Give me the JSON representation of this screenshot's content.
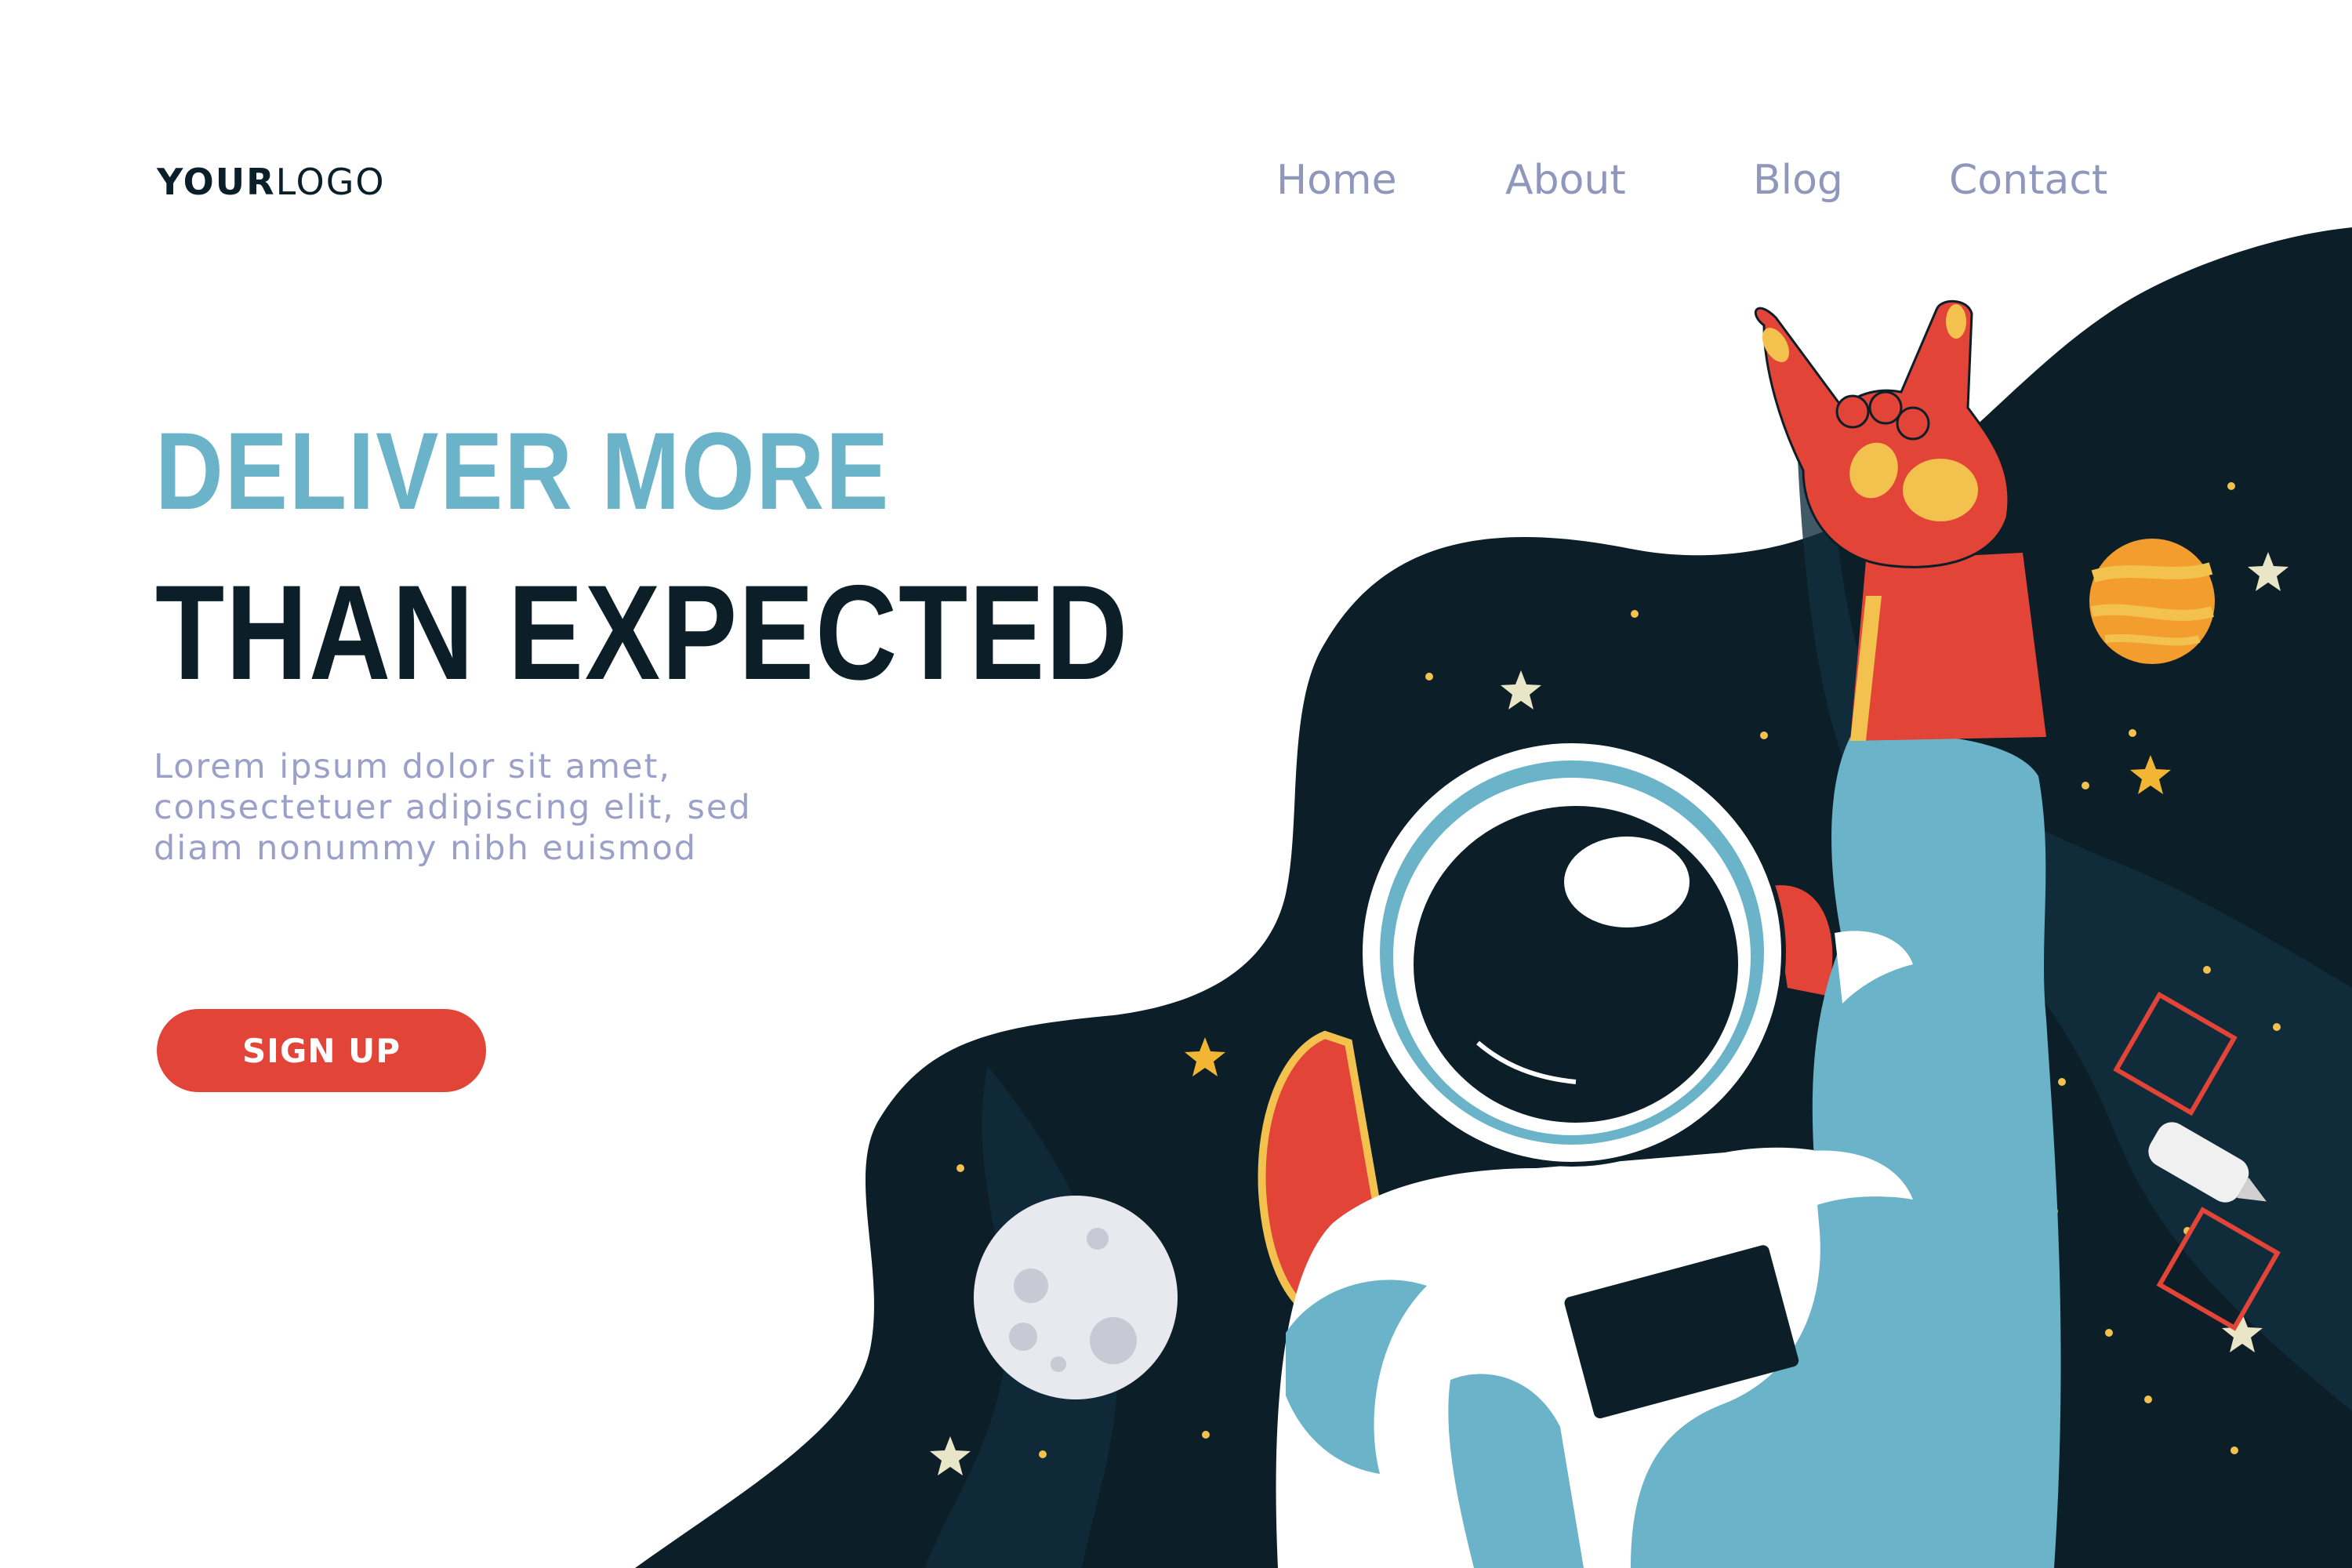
{
  "header": {
    "logo_bold": "YOUR",
    "logo_light": "LOGO",
    "nav": [
      "Home",
      "About",
      "Blog",
      "Contact"
    ]
  },
  "hero": {
    "headline_line1": "DELIVER MORE",
    "headline_line2": "THAN EXPECTED",
    "body_lines": [
      "Lorem ipsum dolor sit amet,",
      "consectetuer adipiscing elit, sed",
      "diam nonummy nibh euismod"
    ],
    "cta_label": "SIGN UP"
  },
  "colors": {
    "background": "#ffffff",
    "space": "#0c1f29",
    "space_light": "#112e3e",
    "headline_accent": "#6bb3c9",
    "headline_dark": "#0c1e28",
    "nav_text": "#8f97bd",
    "cta": "#e24437",
    "suit_blue": "#6bb3c9",
    "glove_red": "#e24437",
    "glove_yellow": "#f2c14e",
    "moon": "#e8e8ef"
  },
  "illustration": {
    "icons": [
      "astronaut-icon",
      "moon-icon",
      "planet-icon",
      "satellite-icon",
      "star-icon"
    ]
  }
}
